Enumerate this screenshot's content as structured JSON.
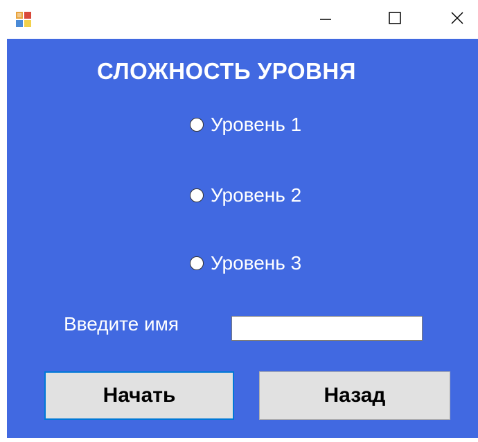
{
  "window": {
    "title_bar": {
      "minimize_icon": "minimize-icon",
      "maximize_icon": "maximize-icon",
      "close_icon": "close-icon",
      "app_icon": "windows-form-icon"
    }
  },
  "form": {
    "background_color": "#4169e1",
    "heading": "СЛОЖНОСТЬ УРОВНЯ",
    "levels": [
      {
        "label": "Уровень 1",
        "selected": false
      },
      {
        "label": "Уровень 2",
        "selected": false
      },
      {
        "label": "Уровень 3",
        "selected": false
      }
    ],
    "name_label": "Введите имя",
    "name_value": "",
    "start_button": "Начать",
    "back_button": "Назад"
  }
}
